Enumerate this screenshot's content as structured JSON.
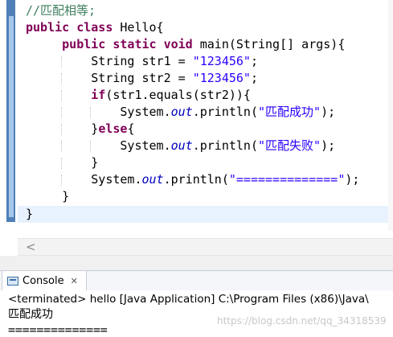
{
  "editor": {
    "lines": [
      {
        "comment": "//匹配相等;"
      },
      {
        "kw1": "public",
        "kw2": "class",
        "text": " Hello{"
      },
      {
        "kw1": "public",
        "kw2": "static",
        "kw3": "void",
        "text": " main(String[] args){"
      },
      {
        "text": "String str1 = ",
        "str": "\"123456\"",
        "tail": ";"
      },
      {
        "text": "String str2 = ",
        "str": "\"123456\"",
        "tail": ";"
      },
      {
        "kw": "if",
        "text": "(str1.equals(str2)){"
      },
      {
        "pre": "System.",
        "field": "out",
        "mid": ".println(",
        "str": "\"匹配成功\"",
        "tail": ");"
      },
      {
        "pre": "}",
        "kw": "else",
        "tail": "{"
      },
      {
        "pre": "System.",
        "field": "out",
        "mid": ".println(",
        "str": "\"匹配失败\"",
        "tail": ");"
      },
      {
        "text": "}"
      },
      {
        "pre": "System.",
        "field": "out",
        "mid": ".println(",
        "str": "\"==============\"",
        "tail": ");"
      },
      {
        "text": "}"
      },
      {
        "text": "}"
      }
    ]
  },
  "scrollbar": {
    "left_arrow": "<"
  },
  "console": {
    "tab_label": "Console",
    "close_glyph": "✕",
    "terminated": "<terminated> hello [Java Application] C:\\Program Files (x86)\\Java\\",
    "output": [
      "匹配成功",
      "=============="
    ]
  },
  "watermark": "https://blog.csdn.net/qq_34318539"
}
